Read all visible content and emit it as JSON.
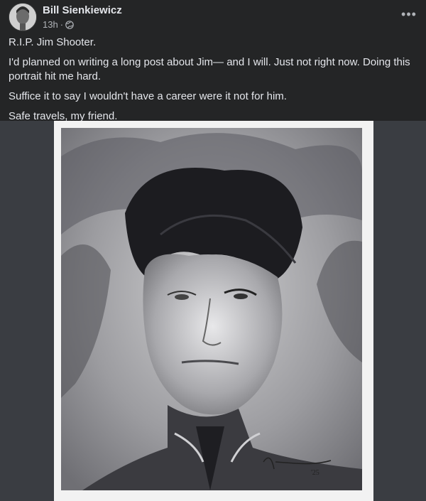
{
  "post": {
    "author": "Bill Sienkiewicz",
    "time": "13h",
    "separator": "·",
    "privacy_icon": "globe-icon",
    "more_icon": "more-options-icon",
    "paragraphs": [
      "R.I.P. Jim Shooter.",
      "I'd planned on writing a long post about Jim— and I will. Just not right now. Doing this portrait hit me hard.",
      "Suffice it to say I wouldn't have a career were it not for him.",
      "Safe travels, my friend."
    ],
    "image_description": "portrait-painting",
    "signature": "'25"
  },
  "colors": {
    "background": "#242526",
    "text": "#e4e6eb",
    "secondary": "#b0b3b8",
    "image_backdrop": "#3a3d42"
  }
}
